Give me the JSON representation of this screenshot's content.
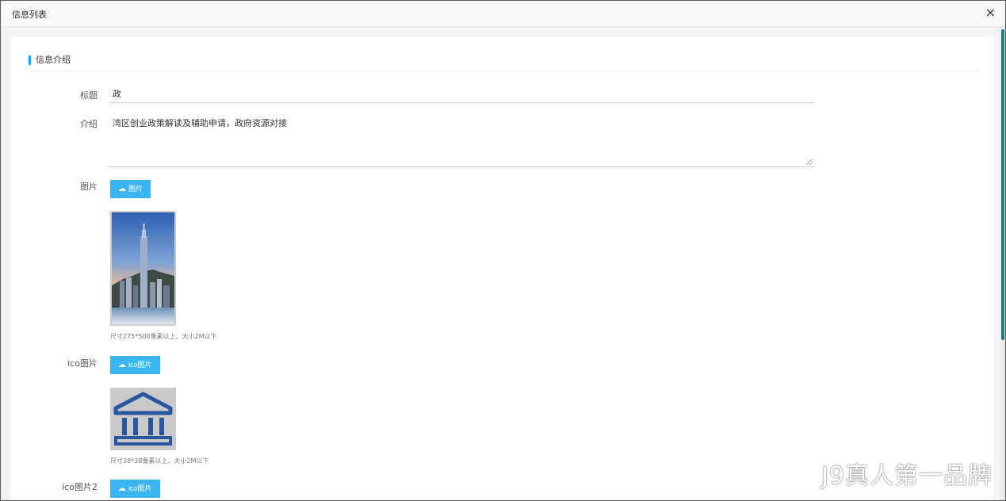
{
  "window": {
    "title": "信息列表",
    "close_glyph": "×"
  },
  "section": {
    "title": "信息介绍"
  },
  "form": {
    "title_label": "标题",
    "title_value": "政",
    "intro_label": "介绍",
    "intro_value": "湾区创业政策解读及辅助申请，政府资源对接",
    "image_label": "图片",
    "image_button": "图片",
    "image_hint": "尺寸275*500像素以上，大小2M以下",
    "ico_label": "ico图片",
    "ico_button": "ico图片",
    "ico_hint": "尺寸38*38像素以上，大小2M以下",
    "ico2_label": "ico图片2",
    "ico2_button": "ico图片"
  },
  "icons": {
    "close": "close-icon",
    "upload": "cloud-upload-icon",
    "bank": "bank-building-icon"
  },
  "colors": {
    "accent": "#3bb4f2",
    "section_bar": "#1e9fff",
    "scroll_thumb": "#1a7f74",
    "ico_blue": "#2a56a0"
  },
  "watermark": "J9真人第一品牌"
}
